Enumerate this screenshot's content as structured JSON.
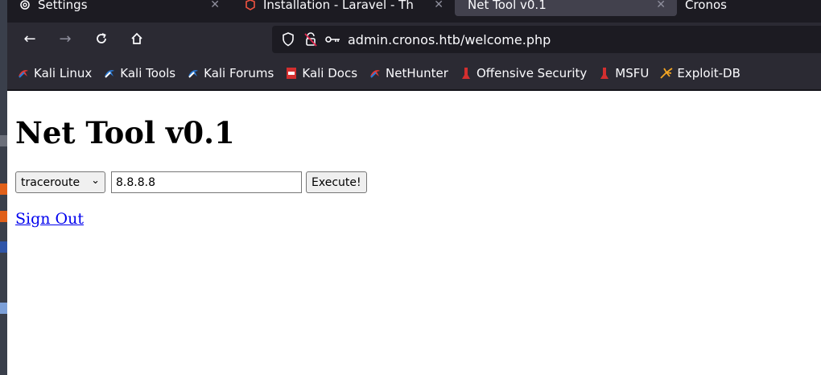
{
  "tabs": [
    {
      "label": "Settings",
      "icon": "gear-icon"
    },
    {
      "label": "Installation - Laravel - Th",
      "icon": "laravel-icon"
    },
    {
      "label": "Net Tool v0.1",
      "icon": ""
    },
    {
      "label": "Cronos",
      "icon": ""
    }
  ],
  "nav": {
    "back": "←",
    "forward": "→",
    "reload": "C",
    "home": "⌂"
  },
  "url": "admin.cronos.htb/welcome.php",
  "bookmarks": [
    {
      "label": "Kali Linux",
      "icon": "kali-icon",
      "color": "#e53935"
    },
    {
      "label": "Kali Tools",
      "icon": "kali-tools-icon",
      "color": "#2b7bd6"
    },
    {
      "label": "Kali Forums",
      "icon": "kali-forums-icon",
      "color": "#2b7bd6"
    },
    {
      "label": "Kali Docs",
      "icon": "kali-docs-icon",
      "color": "#d32f2f"
    },
    {
      "label": "NetHunter",
      "icon": "nethunter-icon",
      "color": "#e53935"
    },
    {
      "label": "Offensive Security",
      "icon": "offsec-icon",
      "color": "#d32f2f"
    },
    {
      "label": "MSFU",
      "icon": "msfu-icon",
      "color": "#d32f2f"
    },
    {
      "label": "Exploit-DB",
      "icon": "exploit-db-icon",
      "color": "#f5a623"
    }
  ],
  "page": {
    "title": "Net Tool v0.1",
    "command_select": "traceroute",
    "host_value": "8.8.8.8",
    "execute_label": "Execute!",
    "signout_label": "Sign Out"
  }
}
